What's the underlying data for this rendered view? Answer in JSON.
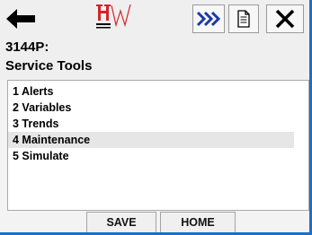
{
  "toolbar": {
    "back_icon": "left-arrow-icon",
    "logo_icon": "hw-logo",
    "next_icon": "fast-forward-chevrons-icon",
    "doc_icon": "document-icon",
    "close_icon": "close-x-icon"
  },
  "header": {
    "device_id": "3144P:",
    "title": "Service Tools"
  },
  "menu": {
    "items": [
      {
        "label": "1 Alerts",
        "selected": false
      },
      {
        "label": "2 Variables",
        "selected": false
      },
      {
        "label": "3 Trends",
        "selected": false
      },
      {
        "label": "4 Maintenance",
        "selected": true
      },
      {
        "label": "5 Simulate",
        "selected": false
      }
    ]
  },
  "footer": {
    "save_label": "SAVE",
    "home_label": "HOME"
  },
  "colors": {
    "frame_accent": "#1c6fc6",
    "logo_red": "#d2232a",
    "chevron_blue": "#1a3aa8"
  }
}
